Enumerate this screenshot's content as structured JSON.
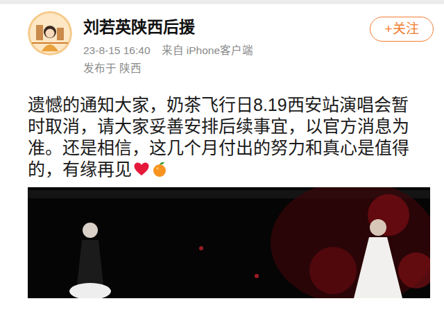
{
  "account": {
    "name": "刘若英陕西后援",
    "follow_button": "+关注",
    "time": "23-8-15 16:40",
    "source": "来自 iPhone客户端",
    "location": "发布于 陕西"
  },
  "post": {
    "text": "遗憾的通知大家，奶茶飞行日8.19西安站演唱会暂时取消，请大家妥善安排后续事宜，以官方消息为准。还是相信，这几个月付出的努力和真心是值得的，有缘再见"
  }
}
